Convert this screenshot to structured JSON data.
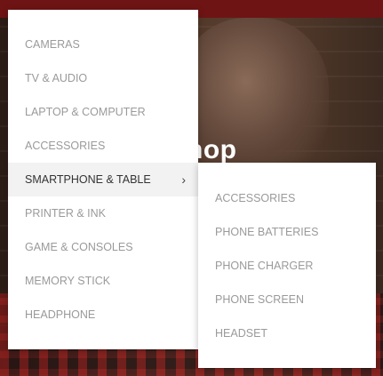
{
  "hero": {
    "title": "hop"
  },
  "menu": {
    "items": [
      {
        "label": "CAMERAS"
      },
      {
        "label": "TV & AUDIO"
      },
      {
        "label": "LAPTOP & COMPUTER"
      },
      {
        "label": "ACCESSORIES"
      },
      {
        "label": "SMARTPHONE & TABLE",
        "active": true,
        "chevron": "›"
      },
      {
        "label": "PRINTER & INK"
      },
      {
        "label": "GAME & CONSOLES"
      },
      {
        "label": "MEMORY STICK"
      },
      {
        "label": "HEADPHONE"
      }
    ]
  },
  "submenu": {
    "items": [
      {
        "label": "ACCESSORIES"
      },
      {
        "label": "PHONE BATTERIES"
      },
      {
        "label": "PHONE CHARGER"
      },
      {
        "label": "PHONE SCREEN"
      },
      {
        "label": "HEADSET"
      }
    ]
  },
  "colors": {
    "top_bar": "#6e1414",
    "menu_text": "#9a9a9a",
    "menu_active_text": "#333333",
    "menu_active_bg": "#f2f2f2"
  }
}
